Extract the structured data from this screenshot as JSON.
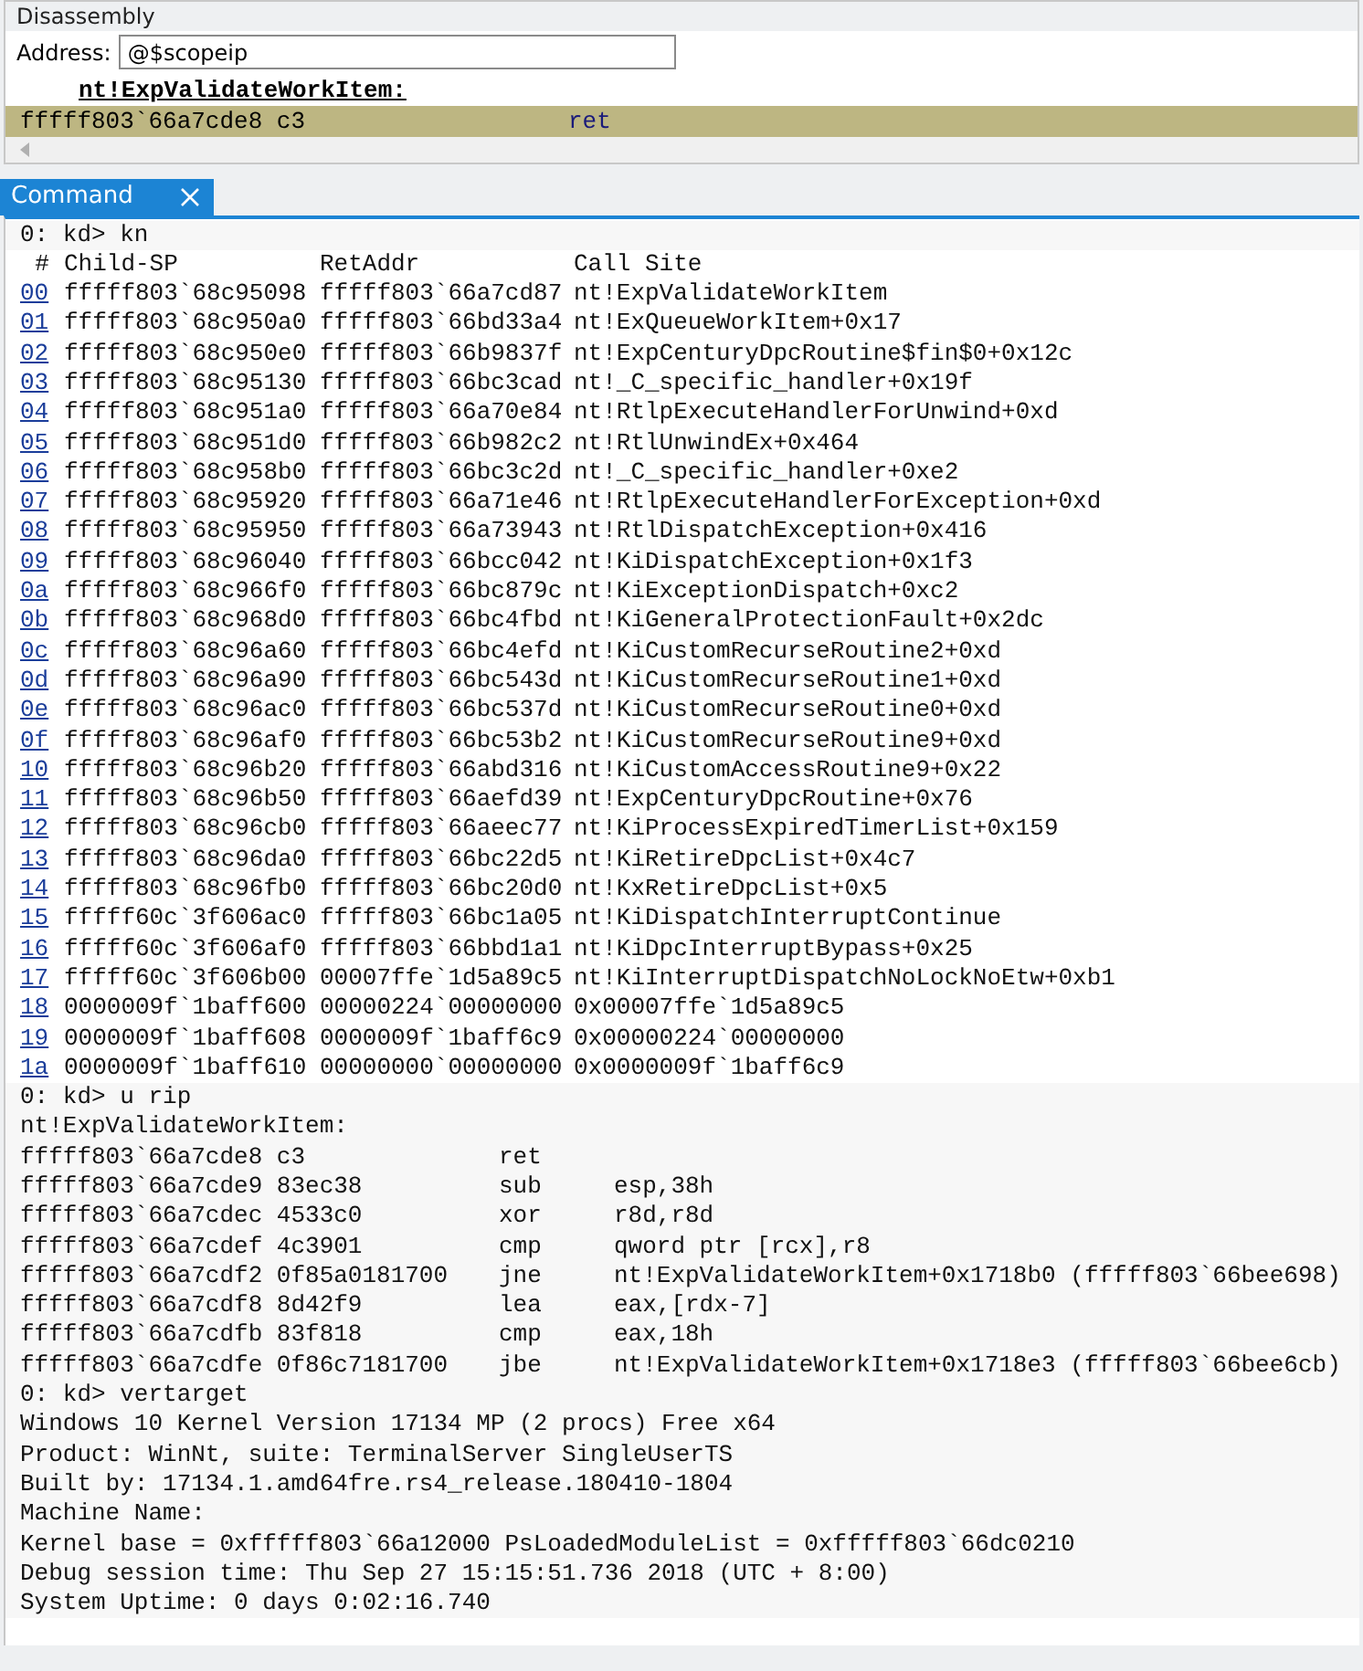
{
  "disassembly": {
    "title": "Disassembly",
    "address": {
      "label": "Address:",
      "value": "@$scopeip"
    },
    "lines": [
      {
        "kind": "label",
        "text": "nt!ExpValidateWorkItem:"
      },
      {
        "kind": "instruction",
        "address_bytes": "fffff803`66a7cde8 c3",
        "mnemonic": "ret",
        "selected": true
      }
    ]
  },
  "command": {
    "tab": {
      "label": "Command",
      "selected": true
    },
    "blocks": [
      {
        "kind": "prompt",
        "text": "0: kd> kn"
      },
      {
        "kind": "stack",
        "columns": [
          "#",
          "Child-SP",
          "RetAddr",
          "Call Site"
        ],
        "rows": [
          {
            "frame": "00",
            "child_sp": "fffff803`68c95098",
            "ret_addr": "fffff803`66a7cd87",
            "call_site": "nt!ExpValidateWorkItem"
          },
          {
            "frame": "01",
            "child_sp": "fffff803`68c950a0",
            "ret_addr": "fffff803`66bd33a4",
            "call_site": "nt!ExQueueWorkItem+0x17"
          },
          {
            "frame": "02",
            "child_sp": "fffff803`68c950e0",
            "ret_addr": "fffff803`66b9837f",
            "call_site": "nt!ExpCenturyDpcRoutine$fin$0+0x12c"
          },
          {
            "frame": "03",
            "child_sp": "fffff803`68c95130",
            "ret_addr": "fffff803`66bc3cad",
            "call_site": "nt!_C_specific_handler+0x19f"
          },
          {
            "frame": "04",
            "child_sp": "fffff803`68c951a0",
            "ret_addr": "fffff803`66a70e84",
            "call_site": "nt!RtlpExecuteHandlerForUnwind+0xd"
          },
          {
            "frame": "05",
            "child_sp": "fffff803`68c951d0",
            "ret_addr": "fffff803`66b982c2",
            "call_site": "nt!RtlUnwindEx+0x464"
          },
          {
            "frame": "06",
            "child_sp": "fffff803`68c958b0",
            "ret_addr": "fffff803`66bc3c2d",
            "call_site": "nt!_C_specific_handler+0xe2"
          },
          {
            "frame": "07",
            "child_sp": "fffff803`68c95920",
            "ret_addr": "fffff803`66a71e46",
            "call_site": "nt!RtlpExecuteHandlerForException+0xd"
          },
          {
            "frame": "08",
            "child_sp": "fffff803`68c95950",
            "ret_addr": "fffff803`66a73943",
            "call_site": "nt!RtlDispatchException+0x416"
          },
          {
            "frame": "09",
            "child_sp": "fffff803`68c96040",
            "ret_addr": "fffff803`66bcc042",
            "call_site": "nt!KiDispatchException+0x1f3"
          },
          {
            "frame": "0a",
            "child_sp": "fffff803`68c966f0",
            "ret_addr": "fffff803`66bc879c",
            "call_site": "nt!KiExceptionDispatch+0xc2"
          },
          {
            "frame": "0b",
            "child_sp": "fffff803`68c968d0",
            "ret_addr": "fffff803`66bc4fbd",
            "call_site": "nt!KiGeneralProtectionFault+0x2dc"
          },
          {
            "frame": "0c",
            "child_sp": "fffff803`68c96a60",
            "ret_addr": "fffff803`66bc4efd",
            "call_site": "nt!KiCustomRecurseRoutine2+0xd"
          },
          {
            "frame": "0d",
            "child_sp": "fffff803`68c96a90",
            "ret_addr": "fffff803`66bc543d",
            "call_site": "nt!KiCustomRecurseRoutine1+0xd"
          },
          {
            "frame": "0e",
            "child_sp": "fffff803`68c96ac0",
            "ret_addr": "fffff803`66bc537d",
            "call_site": "nt!KiCustomRecurseRoutine0+0xd"
          },
          {
            "frame": "0f",
            "child_sp": "fffff803`68c96af0",
            "ret_addr": "fffff803`66bc53b2",
            "call_site": "nt!KiCustomRecurseRoutine9+0xd"
          },
          {
            "frame": "10",
            "child_sp": "fffff803`68c96b20",
            "ret_addr": "fffff803`66abd316",
            "call_site": "nt!KiCustomAccessRoutine9+0x22"
          },
          {
            "frame": "11",
            "child_sp": "fffff803`68c96b50",
            "ret_addr": "fffff803`66aefd39",
            "call_site": "nt!ExpCenturyDpcRoutine+0x76"
          },
          {
            "frame": "12",
            "child_sp": "fffff803`68c96cb0",
            "ret_addr": "fffff803`66aeec77",
            "call_site": "nt!KiProcessExpiredTimerList+0x159"
          },
          {
            "frame": "13",
            "child_sp": "fffff803`68c96da0",
            "ret_addr": "fffff803`66bc22d5",
            "call_site": "nt!KiRetireDpcList+0x4c7"
          },
          {
            "frame": "14",
            "child_sp": "fffff803`68c96fb0",
            "ret_addr": "fffff803`66bc20d0",
            "call_site": "nt!KxRetireDpcList+0x5"
          },
          {
            "frame": "15",
            "child_sp": "fffff60c`3f606ac0",
            "ret_addr": "fffff803`66bc1a05",
            "call_site": "nt!KiDispatchInterruptContinue"
          },
          {
            "frame": "16",
            "child_sp": "fffff60c`3f606af0",
            "ret_addr": "fffff803`66bbd1a1",
            "call_site": "nt!KiDpcInterruptBypass+0x25"
          },
          {
            "frame": "17",
            "child_sp": "fffff60c`3f606b00",
            "ret_addr": "00007ffe`1d5a89c5",
            "call_site": "nt!KiInterruptDispatchNoLockNoEtw+0xb1"
          },
          {
            "frame": "18",
            "child_sp": "0000009f`1baff600",
            "ret_addr": "00000224`00000000",
            "call_site": "0x00007ffe`1d5a89c5"
          },
          {
            "frame": "19",
            "child_sp": "0000009f`1baff608",
            "ret_addr": "0000009f`1baff6c9",
            "call_site": "0x00000224`00000000"
          },
          {
            "frame": "1a",
            "child_sp": "0000009f`1baff610",
            "ret_addr": "00000000`00000000",
            "call_site": "0x0000009f`1baff6c9"
          }
        ]
      },
      {
        "kind": "prompt",
        "text": "0: kd> u rip"
      },
      {
        "kind": "text",
        "text": "nt!ExpValidateWorkItem:"
      },
      {
        "kind": "disasm",
        "lines": [
          {
            "address_bytes": "fffff803`66a7cde8 c3",
            "mnemonic": "ret"
          },
          {
            "address_bytes": "fffff803`66a7cde9 83ec38",
            "mnemonic": "sub",
            "operands": "esp,38h"
          },
          {
            "address_bytes": "fffff803`66a7cdec 4533c0",
            "mnemonic": "xor",
            "operands": "r8d,r8d"
          },
          {
            "address_bytes": "fffff803`66a7cdef 4c3901",
            "mnemonic": "cmp",
            "operands": "qword ptr [rcx],r8"
          },
          {
            "address_bytes": "fffff803`66a7cdf2 0f85a0181700",
            "mnemonic": "jne",
            "operands": "nt!ExpValidateWorkItem+0x1718b0 (fffff803`66bee698)"
          },
          {
            "address_bytes": "fffff803`66a7cdf8 8d42f9",
            "mnemonic": "lea",
            "operands": "eax,[rdx-7]"
          },
          {
            "address_bytes": "fffff803`66a7cdfb 83f818",
            "mnemonic": "cmp",
            "operands": "eax,18h"
          },
          {
            "address_bytes": "fffff803`66a7cdfe 0f86c7181700",
            "mnemonic": "jbe",
            "operands": "nt!ExpValidateWorkItem+0x1718e3 (fffff803`66bee6cb)"
          }
        ]
      },
      {
        "kind": "prompt",
        "text": "0: kd> vertarget"
      },
      {
        "kind": "text",
        "text": "Windows 10 Kernel Version 17134 MP (2 procs) Free x64"
      },
      {
        "kind": "text",
        "text": "Product: WinNt, suite: TerminalServer SingleUserTS"
      },
      {
        "kind": "text",
        "text": "Built by: 17134.1.amd64fre.rs4_release.180410-1804"
      },
      {
        "kind": "text",
        "text": "Machine Name:"
      },
      {
        "kind": "text",
        "text": "Kernel base = 0xfffff803`66a12000 PsLoadedModuleList = 0xfffff803`66dc0210"
      },
      {
        "kind": "text",
        "text": "Debug session time: Thu Sep 27 15:15:51.736 2018 (UTC + 8:00)"
      },
      {
        "kind": "text",
        "text": "System Uptime: 0 days 0:02:16.740"
      }
    ]
  }
}
